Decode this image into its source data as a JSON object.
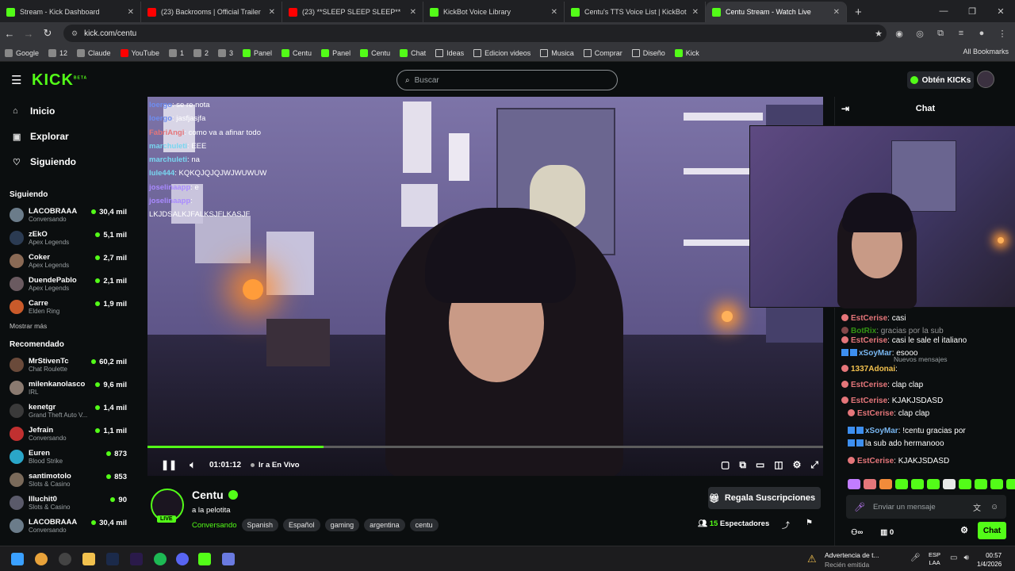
{
  "tabs": [
    {
      "title": "Stream - Kick Dashboard",
      "fav": "kick"
    },
    {
      "title": "(23) Backrooms | Official Trailer",
      "fav": "yt"
    },
    {
      "title": "(23) **SLEEP SLEEP SLEEP**",
      "fav": "yt"
    },
    {
      "title": "KickBot Voice Library",
      "fav": "kick"
    },
    {
      "title": "Centu's TTS Voice List | KickBot",
      "fav": "kick"
    },
    {
      "title": "Centu Stream - Watch Live",
      "fav": "kick"
    }
  ],
  "address": {
    "url": "kick.com/centu"
  },
  "bookmarks": [
    "Google",
    "12",
    "Claude",
    "YouTube",
    "1",
    "2",
    "3",
    "Panel",
    "Centu",
    "Panel",
    "Centu",
    "Chat",
    "Ideas",
    "Edicion videos",
    "Musica",
    "Comprar",
    "Diseño",
    "Kick"
  ],
  "all_bookmarks": "All Bookmarks",
  "header": {
    "logo": "KICK",
    "logo_sup": "BETA",
    "search_placeholder": "Buscar",
    "get_kicks": "Obtén KICKs"
  },
  "sidebar": {
    "nav": [
      {
        "label": "Inicio",
        "icon": "home-icon"
      },
      {
        "label": "Explorar",
        "icon": "compass-icon"
      },
      {
        "label": "Siguiendo",
        "icon": "heart-icon"
      }
    ],
    "following_title": "Siguiendo",
    "following": [
      {
        "name": "LACOBRAAA",
        "cat": "Conversando",
        "viewers": "30,4 mil",
        "color": "#6b7c8a"
      },
      {
        "name": "zEkO",
        "cat": "Apex Legends",
        "viewers": "5,1 mil",
        "color": "#2b3b52"
      },
      {
        "name": "Coker",
        "cat": "Apex Legends",
        "viewers": "2,7 mil",
        "color": "#8a6a55"
      },
      {
        "name": "DuendePablo",
        "cat": "Apex Legends",
        "viewers": "2,1 mil",
        "color": "#6a5a60"
      },
      {
        "name": "Carre",
        "cat": "Elden Ring",
        "viewers": "1,9 mil",
        "color": "#c95a2a"
      }
    ],
    "show_more": "Mostrar más",
    "recommended_title": "Recomendado",
    "recommended": [
      {
        "name": "MrStivenTc",
        "cat": "Chat Roulette",
        "viewers": "60,2 mil",
        "color": "#6a4a3a"
      },
      {
        "name": "milenkanolasco",
        "cat": "IRL",
        "viewers": "9,6 mil",
        "color": "#8a7a70"
      },
      {
        "name": "kenetgr",
        "cat": "Grand Theft Auto V...",
        "viewers": "1,4 mil",
        "color": "#3a3a3a"
      },
      {
        "name": "Jefrain",
        "cat": "Conversando",
        "viewers": "1,1 mil",
        "color": "#c03030"
      },
      {
        "name": "Euren",
        "cat": "Blood Strike",
        "viewers": "873",
        "color": "#2aa6c8"
      },
      {
        "name": "santimotolo",
        "cat": "Slots & Casino",
        "viewers": "853",
        "color": "#7a6a5a"
      },
      {
        "name": "Illuchit0",
        "cat": "Slots & Casino",
        "viewers": "90",
        "color": "#5a5a6a"
      },
      {
        "name": "LACOBRAAA",
        "cat": "Conversando",
        "viewers": "30,4 mil",
        "color": "#6b7c8a"
      }
    ]
  },
  "video": {
    "overlay_chat": [
      {
        "user": "Ioergo",
        "text": ": se re nota",
        "c": "c1"
      },
      {
        "user": "Ioergo",
        "text": ": jasfjasjfa",
        "c": "c1"
      },
      {
        "user": "FabriAngi",
        "text": ": como va a afinar todo",
        "c": "c3"
      },
      {
        "user": "marchuleti",
        "text": ": EEE",
        "c": "c2"
      },
      {
        "user": "marchuleti",
        "text": ": na",
        "c": "c2"
      },
      {
        "user": "lule444",
        "text": ": KQKQJQJQJWJWUWUW",
        "c": "c2"
      },
      {
        "user": "joselinaapp",
        "text": ": e",
        "c": "c4"
      },
      {
        "user": "joselinaapp",
        "text": ":",
        "c": "c4"
      },
      {
        "user": "",
        "text": "LKJDSALKJFALKSJFLKASJF",
        "c": "c5"
      }
    ],
    "progress": 0.26,
    "time": "01:01:12",
    "live_label": "Ir a En Vivo"
  },
  "stream": {
    "name": "Centu",
    "title": "a la pelotita",
    "live_badge": "LIVE",
    "category": "Conversando",
    "tags": [
      "Spanish",
      "Español",
      "gaming",
      "argentina",
      "centu"
    ],
    "subs_button": "Regala Suscripciones",
    "viewers": "15",
    "viewers_label": "Espectadores"
  },
  "chat": {
    "title": "Chat",
    "messages": [
      {
        "user": "EstCerise",
        "text": ": casi",
        "color": "r"
      },
      {
        "user": "BotRix",
        "text": ": gracias por la sub",
        "color": "g",
        "ghost": true
      },
      {
        "user": "EstCerise",
        "text": ": casi le sale el italiano",
        "color": "r"
      },
      {
        "user": "xSoyMar",
        "text": ": esooo",
        "color": "b"
      },
      {
        "user": "1337Adonai",
        "text": ":",
        "color": "y"
      },
      {
        "user": "EstCerise",
        "text": ": clap clap",
        "color": "r"
      },
      {
        "user": "EstCerise",
        "text": ": KJAKJSDASD",
        "color": "r"
      },
      {
        "user": "EstCerise",
        "text": ": clap clap",
        "color": "r"
      },
      {
        "user": "xSoyMar",
        "text": ": !centu gracias por",
        "color": "b"
      },
      {
        "user": "",
        "text": "la sub ado hermanooo",
        "color": "b"
      },
      {
        "user": "EstCerise",
        "text": ": KJAKJSDASD",
        "color": "r"
      }
    ],
    "new_messages": "Nuevos mensajes",
    "input_placeholder": "Enviar un mensaje",
    "points": "0",
    "send_button": "Chat"
  },
  "taskbar": {
    "notification_title": "Advertencia de t...",
    "notification_sub": "Recién emitida",
    "lang1": "ESP",
    "lang2": "LAA",
    "time": "00:57",
    "date": "1/4/2026"
  }
}
